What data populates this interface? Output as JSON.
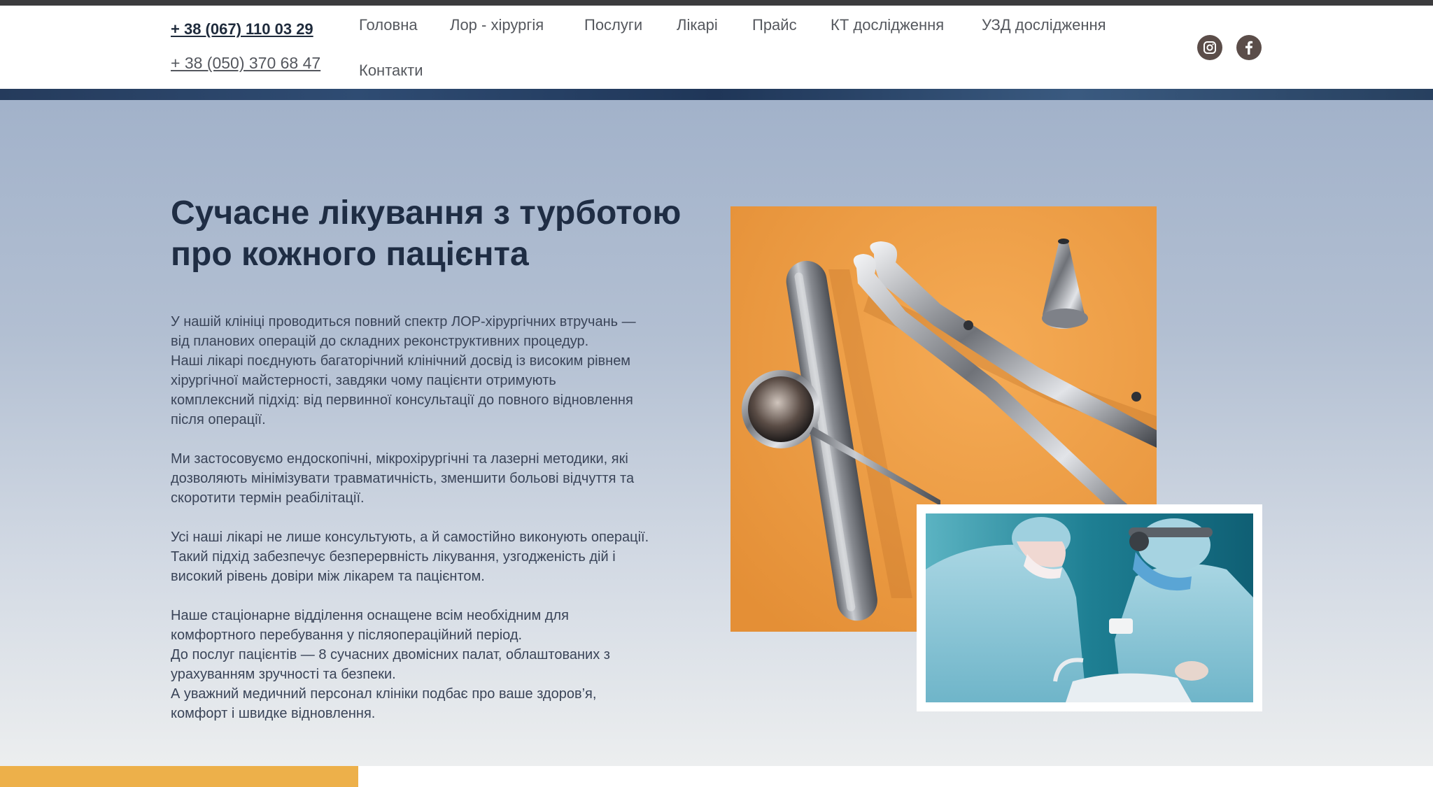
{
  "header": {
    "phones": [
      "+ 38 (067) 110 03 29",
      "+ 38 (050) 370 68 47"
    ],
    "nav": [
      {
        "label": "Головна"
      },
      {
        "label": "Лор - хірургія"
      },
      {
        "label": "Послуги"
      },
      {
        "label": "Лікарі"
      },
      {
        "label": "Прайс"
      },
      {
        "label": "КТ дослідження"
      },
      {
        "label": "УЗД дослідження"
      },
      {
        "label": "Контакти"
      }
    ],
    "social": [
      {
        "icon": "instagram-icon"
      },
      {
        "icon": "facebook-icon"
      }
    ]
  },
  "hero": {
    "title_line1": "Сучасне лікування з турботою",
    "title_line2": "про кожного пацієнта",
    "paragraphs": [
      {
        "lines": [
          "У нашій клініці проводиться повний спектр ЛОР-хірургічних втручань —",
          "від планових операцій до складних реконструктивних процедур.",
          "Наші лікарі поєднують багаторічний клінічний досвід із високим рівнем",
          "хірургічної майстерності, завдяки чому пацієнти отримують",
          "комплексний підхід: від первинної консультації до повного відновлення",
          "після операції."
        ]
      },
      {
        "lines": [
          "Ми застосовуємо ендоскопічні, мікрохірургічні та лазерні методики, які",
          "дозволяють мінімізувати травматичність, зменшити больові відчуття та",
          "скоротити термін реабілітації."
        ]
      },
      {
        "lines": [
          "Усі наші лікарі не лише консультують, а й самостійно виконують операції.",
          "Такий підхід забезпечує безперервність лікування, узгодженість дій і",
          "високий рівень довіри між лікарем та пацієнтом."
        ]
      },
      {
        "lines": [
          "Наше стаціонарне відділення оснащене всім необхідним для",
          "комфортного перебування у післяопераційний період.",
          "До послуг пацієнтів — 8 сучасних двомісних палат, облаштованих з",
          "урахуванням зручності та безпеки.",
          "А уважний медичний персонал клініки подбає про ваше здоров’я,",
          "комфорт і швидке відновлення."
        ]
      }
    ]
  },
  "colors": {
    "title": "#1f2d44",
    "text": "#3a4458",
    "accent": "#edb04a",
    "hero_top": "#a2b2ca",
    "hero_bottom": "#eceeef"
  }
}
